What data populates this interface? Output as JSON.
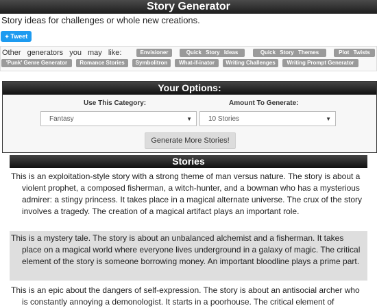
{
  "header": {
    "title": "Story Generator",
    "subtitle": "Story ideas for challenges or whole new creations."
  },
  "tweet": {
    "label": "Tweet",
    "icon": "twitter-bird-icon",
    "color": "#1d9bf0"
  },
  "generators": {
    "label": "Other generators you may like:",
    "items": [
      "Envisioner",
      "Quick Story Ideas",
      "Quick Story Themes",
      "Plot Twists",
      "'Punk' Genre Generator",
      "Romance Stories",
      "Symbolitron",
      "What-if-inator",
      "Writing Challenges",
      "Writing Prompt Generator"
    ]
  },
  "options": {
    "title": "Your Options:",
    "category_label": "Use This Category:",
    "category_value": "Fantasy",
    "amount_label": "Amount To Generate:",
    "amount_value": "10 Stories",
    "button_label": "Generate More Stories!"
  },
  "stories": {
    "title": "Stories",
    "items": [
      "This is an exploitation-style story with a strong theme of man versus nature. The story is about a violent prophet, a composed fisherman, a witch-hunter, and a bowman who has a mysterious admirer: a stingy princess. It takes place in a magical alternate universe. The crux of the story involves a tragedy. The creation of a magical artifact plays an important role.",
      "This is a mystery tale. The story is about an unbalanced alchemist and a fisherman. It takes place on a magical world where everyone lives underground in a galaxy of magic. The critical element of the story is someone borrowing money. An important bloodline plays a prime part.",
      "This is an epic about the dangers of self-expression. The story is about an antisocial archer who is constantly annoying a demonologist. It starts in a poorhouse. The critical element of"
    ]
  }
}
